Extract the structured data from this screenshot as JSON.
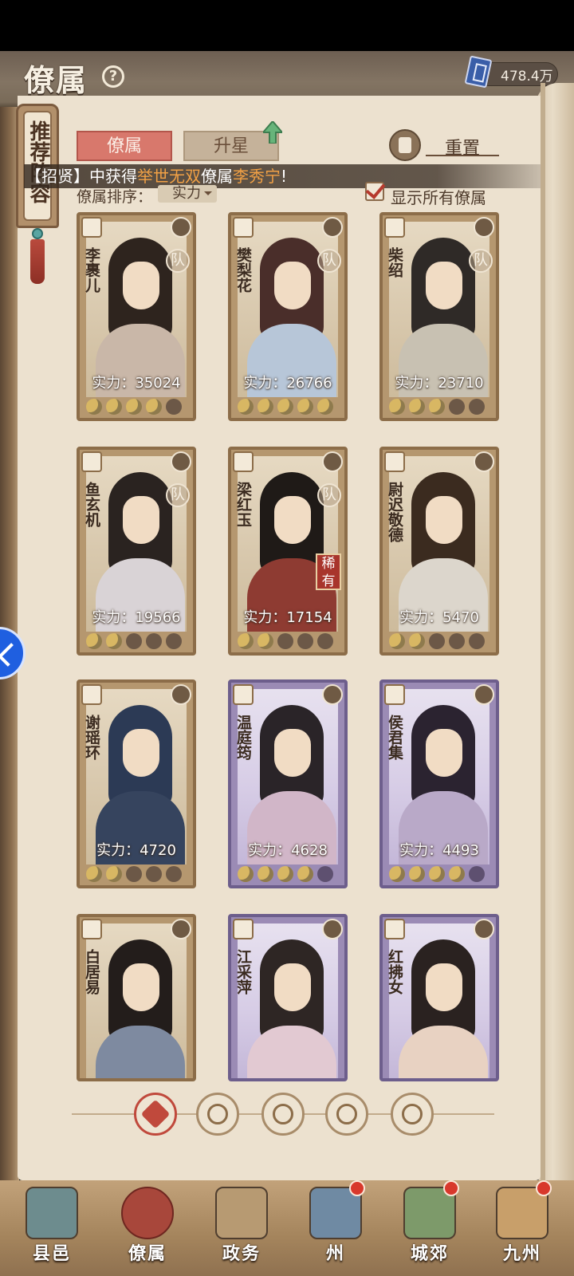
{
  "header": {
    "title": "僚属",
    "help_icon": "help-circle-icon",
    "currency": {
      "icon": "book-icon",
      "value": "478.4万"
    }
  },
  "side_tag": {
    "label": "推荐阵容"
  },
  "tabs": [
    {
      "label": "僚属",
      "active": true
    },
    {
      "label": "升星",
      "active": false
    }
  ],
  "reset": {
    "label": "重置",
    "icon": "reset-icon"
  },
  "notice": {
    "prefix": "招贤】中获得",
    "highlight1": "举世无双",
    "middle": "僚属",
    "highlight2": "李秀宁",
    "suffix": "!"
  },
  "sort": {
    "label": "僚属排序：",
    "value": "实力"
  },
  "filter": {
    "label": "显示所有僚属",
    "checked": true
  },
  "cards": [
    {
      "name": "李裹儿",
      "power": "实力：35024",
      "stars": 4,
      "rarity": "gold",
      "team": "队",
      "rare_tag": ""
    },
    {
      "name": "樊梨花",
      "power": "实力：26766",
      "stars": 5,
      "rarity": "gold",
      "team": "队",
      "rare_tag": ""
    },
    {
      "name": "柴绍",
      "power": "实力：23710",
      "stars": 3,
      "rarity": "gold",
      "team": "队",
      "rare_tag": ""
    },
    {
      "name": "鱼玄机",
      "power": "实力：19566",
      "stars": 2,
      "rarity": "gold",
      "team": "队",
      "rare_tag": ""
    },
    {
      "name": "梁红玉",
      "power": "实力：17154",
      "stars": 2,
      "rarity": "gold",
      "team": "队",
      "rare_tag": "稀有"
    },
    {
      "name": "尉迟敬德",
      "power": "实力：5470",
      "stars": 2,
      "rarity": "gold",
      "team": "",
      "rare_tag": ""
    },
    {
      "name": "谢瑶环",
      "power": "实力：4720",
      "stars": 2,
      "rarity": "gold",
      "team": "",
      "rare_tag": ""
    },
    {
      "name": "温庭筠",
      "power": "实力：4628",
      "stars": 4,
      "rarity": "purple",
      "team": "",
      "rare_tag": ""
    },
    {
      "name": "侯君集",
      "power": "实力：4493",
      "stars": 4,
      "rarity": "purple",
      "team": "",
      "rare_tag": ""
    },
    {
      "name": "白居易",
      "power": "",
      "stars": 0,
      "rarity": "gold",
      "team": "",
      "rare_tag": ""
    },
    {
      "name": "江采萍",
      "power": "",
      "stars": 0,
      "rarity": "purple",
      "team": "",
      "rare_tag": ""
    },
    {
      "name": "红拂女",
      "power": "",
      "stars": 0,
      "rarity": "purple",
      "team": "",
      "rare_tag": ""
    }
  ],
  "categories": [
    {
      "icon": "all-categories-icon",
      "active": true
    },
    {
      "icon": "bell-hat-icon",
      "active": false
    },
    {
      "icon": "gourd-icon",
      "active": false
    },
    {
      "icon": "fan-icon",
      "active": false
    },
    {
      "icon": "lion-icon",
      "active": false
    }
  ],
  "bottom_nav": [
    {
      "label": "县邑",
      "icon": "gate-icon",
      "active": false,
      "dot": false
    },
    {
      "label": "僚属",
      "icon": "scroll-icon",
      "active": true,
      "dot": false
    },
    {
      "label": "政务",
      "icon": "documents-icon",
      "active": false,
      "dot": false
    },
    {
      "label": "州",
      "icon": "pavilion-icon",
      "active": false,
      "dot": true
    },
    {
      "label": "城郊",
      "icon": "countryside-icon",
      "active": false,
      "dot": true
    },
    {
      "label": "九州",
      "icon": "map-icon",
      "active": false,
      "dot": true
    }
  ],
  "colors": {
    "accent_red": "#d8786c",
    "highlight_orange": "#f2a145",
    "page_bg": "#ece1cf",
    "card_gold": "#b5976f",
    "card_purple": "#9b8bb5"
  }
}
